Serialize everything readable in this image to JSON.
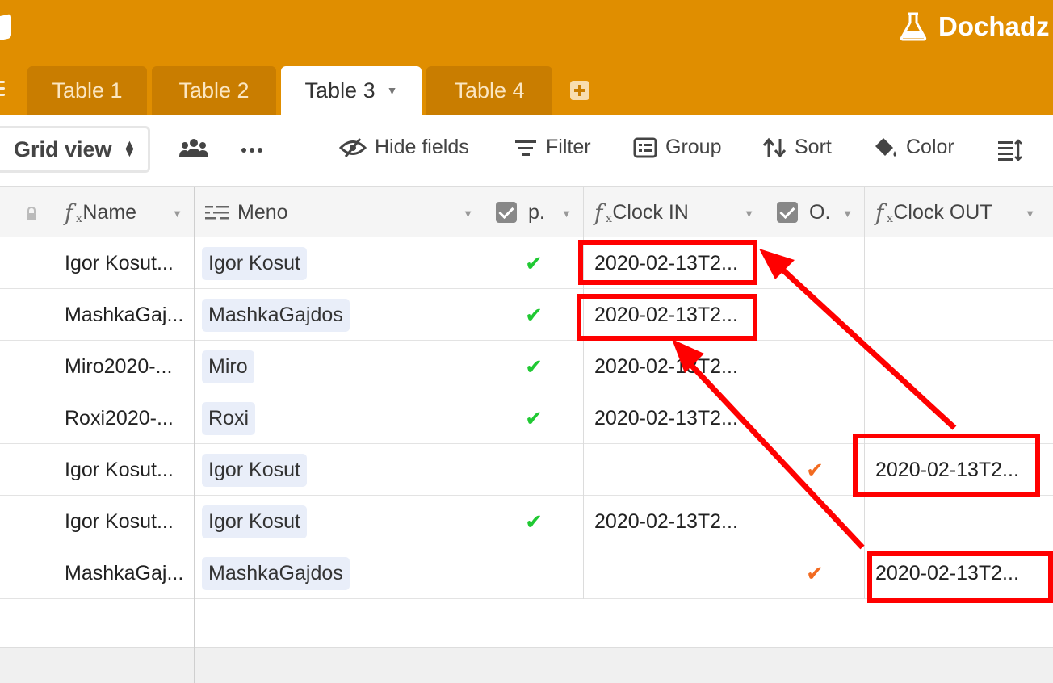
{
  "header": {
    "app_title": "Dochadz",
    "tabs": [
      {
        "label": "Table 1",
        "active": false
      },
      {
        "label": "Table 2",
        "active": false
      },
      {
        "label": "Table 3",
        "active": true
      },
      {
        "label": "Table 4",
        "active": false
      }
    ]
  },
  "toolbar": {
    "view_label": "Grid view",
    "hide_fields": "Hide fields",
    "filter": "Filter",
    "group": "Group",
    "sort": "Sort",
    "color": "Color"
  },
  "columns": {
    "name": "Name",
    "meno": "Meno",
    "p": "p.",
    "clock_in": "Clock IN",
    "o": "O.",
    "clock_out": "Clock OUT"
  },
  "rows": [
    {
      "name": "Igor Kosut...",
      "meno": "Igor Kosut",
      "p": true,
      "clock_in": "2020-02-13T2...",
      "o": false,
      "clock_out": ""
    },
    {
      "name": "MashkaGaj...",
      "meno": "MashkaGajdos",
      "p": true,
      "clock_in": "2020-02-13T2...",
      "o": false,
      "clock_out": ""
    },
    {
      "name": "Miro2020-...",
      "meno": "Miro",
      "p": true,
      "clock_in": "2020-02-13T2...",
      "o": false,
      "clock_out": ""
    },
    {
      "name": "Roxi2020-...",
      "meno": "Roxi",
      "p": true,
      "clock_in": "2020-02-13T2...",
      "o": false,
      "clock_out": ""
    },
    {
      "name": "Igor Kosut...",
      "meno": "Igor Kosut",
      "p": false,
      "clock_in": "",
      "o": true,
      "clock_out": "2020-02-13T2..."
    },
    {
      "name": "Igor Kosut...",
      "meno": "Igor Kosut",
      "p": true,
      "clock_in": "2020-02-13T2...",
      "o": false,
      "clock_out": ""
    },
    {
      "name": "MashkaGaj...",
      "meno": "MashkaGajdos",
      "p": false,
      "clock_in": "",
      "o": true,
      "clock_out": "2020-02-13T2..."
    }
  ],
  "colors": {
    "header_bg": "#e08e00",
    "tab_inactive": "#c97d00",
    "annotation": "#ff0000",
    "check_green": "#20c933",
    "check_orange": "#f26b21"
  }
}
